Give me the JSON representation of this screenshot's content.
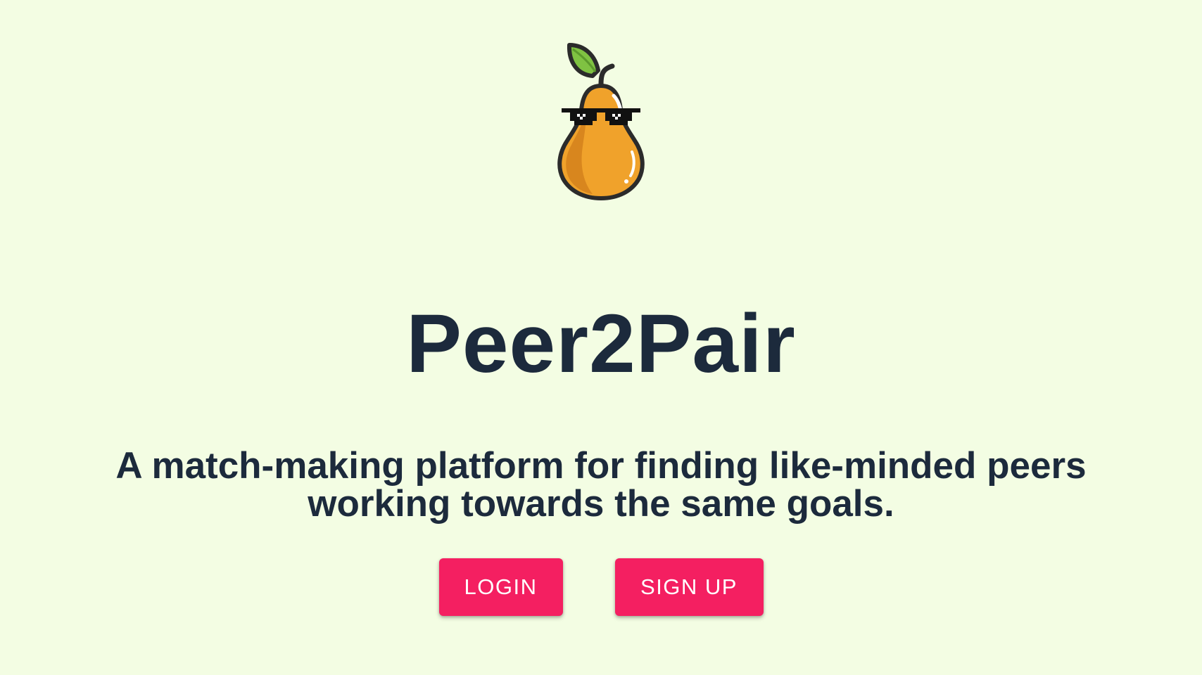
{
  "app": {
    "title": "Peer2Pair",
    "tagline": "A match-making platform for finding like-minded peers working towards the same goals.",
    "logo_icon": "pear-with-sunglasses-icon"
  },
  "actions": {
    "login_label": "LOGIN",
    "signup_label": "SIGN UP"
  },
  "colors": {
    "background": "#f3fde3",
    "text": "#1c2a3c",
    "button": "#f41f61",
    "pear": "#f0a22b",
    "leaf": "#7fc242"
  }
}
